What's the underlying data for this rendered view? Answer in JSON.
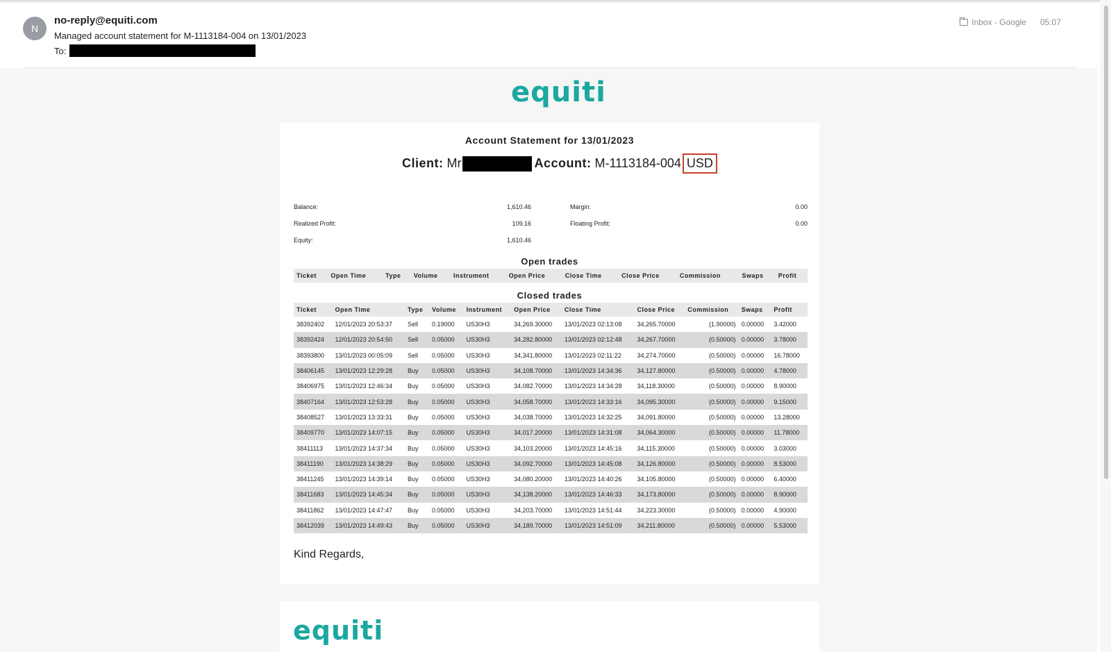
{
  "header": {
    "avatar_letter": "N",
    "sender": "no-reply@equiti.com",
    "subject": "Managed account statement for M-1113184-004 on 13/01/2023",
    "to_label": "To:",
    "folder": "Inbox - Google",
    "time": "05:07"
  },
  "email": {
    "logo": "equiti",
    "statement_title": "Account Statement for 13/01/2023",
    "client_label": "Client:",
    "client_prefix": "Mr",
    "account_label": "Account:",
    "account_number": "M-1113184-004",
    "currency": "USD",
    "summary": {
      "balance_label": "Balance:",
      "balance": "1,610.46",
      "margin_label": "Margin:",
      "margin": "0.00",
      "realized_label": "Realized Profit:",
      "realized": "109.16",
      "floating_label": "Floating Profit:",
      "floating": "0.00",
      "equity_label": "Equity:",
      "equity": "1,610.46"
    },
    "open_trades_title": "Open trades",
    "closed_trades_title": "Closed trades",
    "open_columns": [
      "Ticket",
      "Open Time",
      "Type",
      "Volume",
      "Instrument",
      "Open Price",
      "Close Time",
      "Close Price",
      "Commission",
      "Swaps",
      "Profit"
    ],
    "closed_columns": [
      "Ticket",
      "Open Time",
      "Type",
      "Volume",
      "Instrument",
      "Open Price",
      "Close Time",
      "Close Price",
      "Commission",
      "Swaps",
      "Profit"
    ],
    "closed_trades": [
      [
        "38392402",
        "12/01/2023 20:53:37",
        "Sell",
        "0.19000",
        "US30H3",
        "34,269.30000",
        "13/01/2023 02:13:08",
        "34,265.70000",
        "(1.90000)",
        "0.00000",
        "3.42000"
      ],
      [
        "38392424",
        "12/01/2023 20:54:50",
        "Sell",
        "0.05000",
        "US30H3",
        "34,282.80000",
        "13/01/2023 02:12:48",
        "34,267.70000",
        "(0.50000)",
        "0.00000",
        "3.78000"
      ],
      [
        "38393800",
        "13/01/2023 00:05:09",
        "Sell",
        "0.05000",
        "US30H3",
        "34,341.80000",
        "13/01/2023 02:11:22",
        "34,274.70000",
        "(0.50000)",
        "0.00000",
        "16.78000"
      ],
      [
        "38406145",
        "13/01/2023 12:29:28",
        "Buy",
        "0.05000",
        "US30H3",
        "34,108.70000",
        "13/01/2023 14:34:36",
        "34,127.80000",
        "(0.50000)",
        "0.00000",
        "4.78000"
      ],
      [
        "38406975",
        "13/01/2023 12:46:34",
        "Buy",
        "0.05000",
        "US30H3",
        "34,082.70000",
        "13/01/2023 14:34:28",
        "34,118.30000",
        "(0.50000)",
        "0.00000",
        "8.90000"
      ],
      [
        "38407164",
        "13/01/2023 12:53:28",
        "Buy",
        "0.05000",
        "US30H3",
        "34,058.70000",
        "13/01/2023 14:33:16",
        "34,095.30000",
        "(0.50000)",
        "0.00000",
        "9.15000"
      ],
      [
        "38408527",
        "13/01/2023 13:33:31",
        "Buy",
        "0.05000",
        "US30H3",
        "34,038.70000",
        "13/01/2023 14:32:25",
        "34,091.80000",
        "(0.50000)",
        "0.00000",
        "13.28000"
      ],
      [
        "38409770",
        "13/01/2023 14:07:15",
        "Buy",
        "0.05000",
        "US30H3",
        "34,017.20000",
        "13/01/2023 14:31:08",
        "34,064.30000",
        "(0.50000)",
        "0.00000",
        "11.78000"
      ],
      [
        "38411113",
        "13/01/2023 14:37:34",
        "Buy",
        "0.05000",
        "US30H3",
        "34,103.20000",
        "13/01/2023 14:45:16",
        "34,115.30000",
        "(0.50000)",
        "0.00000",
        "3.03000"
      ],
      [
        "38411190",
        "13/01/2023 14:38:29",
        "Buy",
        "0.05000",
        "US30H3",
        "34,092.70000",
        "13/01/2023 14:45:08",
        "34,126.80000",
        "(0.50000)",
        "0.00000",
        "8.53000"
      ],
      [
        "38411245",
        "13/01/2023 14:39:14",
        "Buy",
        "0.05000",
        "US30H3",
        "34,080.20000",
        "13/01/2023 14:40:26",
        "34,105.80000",
        "(0.50000)",
        "0.00000",
        "6.40000"
      ],
      [
        "38411683",
        "13/01/2023 14:45:34",
        "Buy",
        "0.05000",
        "US30H3",
        "34,138.20000",
        "13/01/2023 14:46:33",
        "34,173.80000",
        "(0.50000)",
        "0.00000",
        "8.90000"
      ],
      [
        "38411862",
        "13/01/2023 14:47:47",
        "Buy",
        "0.05000",
        "US30H3",
        "34,203.70000",
        "13/01/2023 14:51:44",
        "34,223.30000",
        "(0.50000)",
        "0.00000",
        "4.90000"
      ],
      [
        "38412039",
        "13/01/2023 14:49:43",
        "Buy",
        "0.05000",
        "US30H3",
        "34,189.70000",
        "13/01/2023 14:51:09",
        "34,211.80000",
        "(0.50000)",
        "0.00000",
        "5.53000"
      ]
    ],
    "regards": "Kind Regards,",
    "footer_logo": "equiti"
  },
  "colors": {
    "brand": "#1aa8a0",
    "highlight_box": "#c8412b",
    "row_alt": "#d9d9d9"
  }
}
